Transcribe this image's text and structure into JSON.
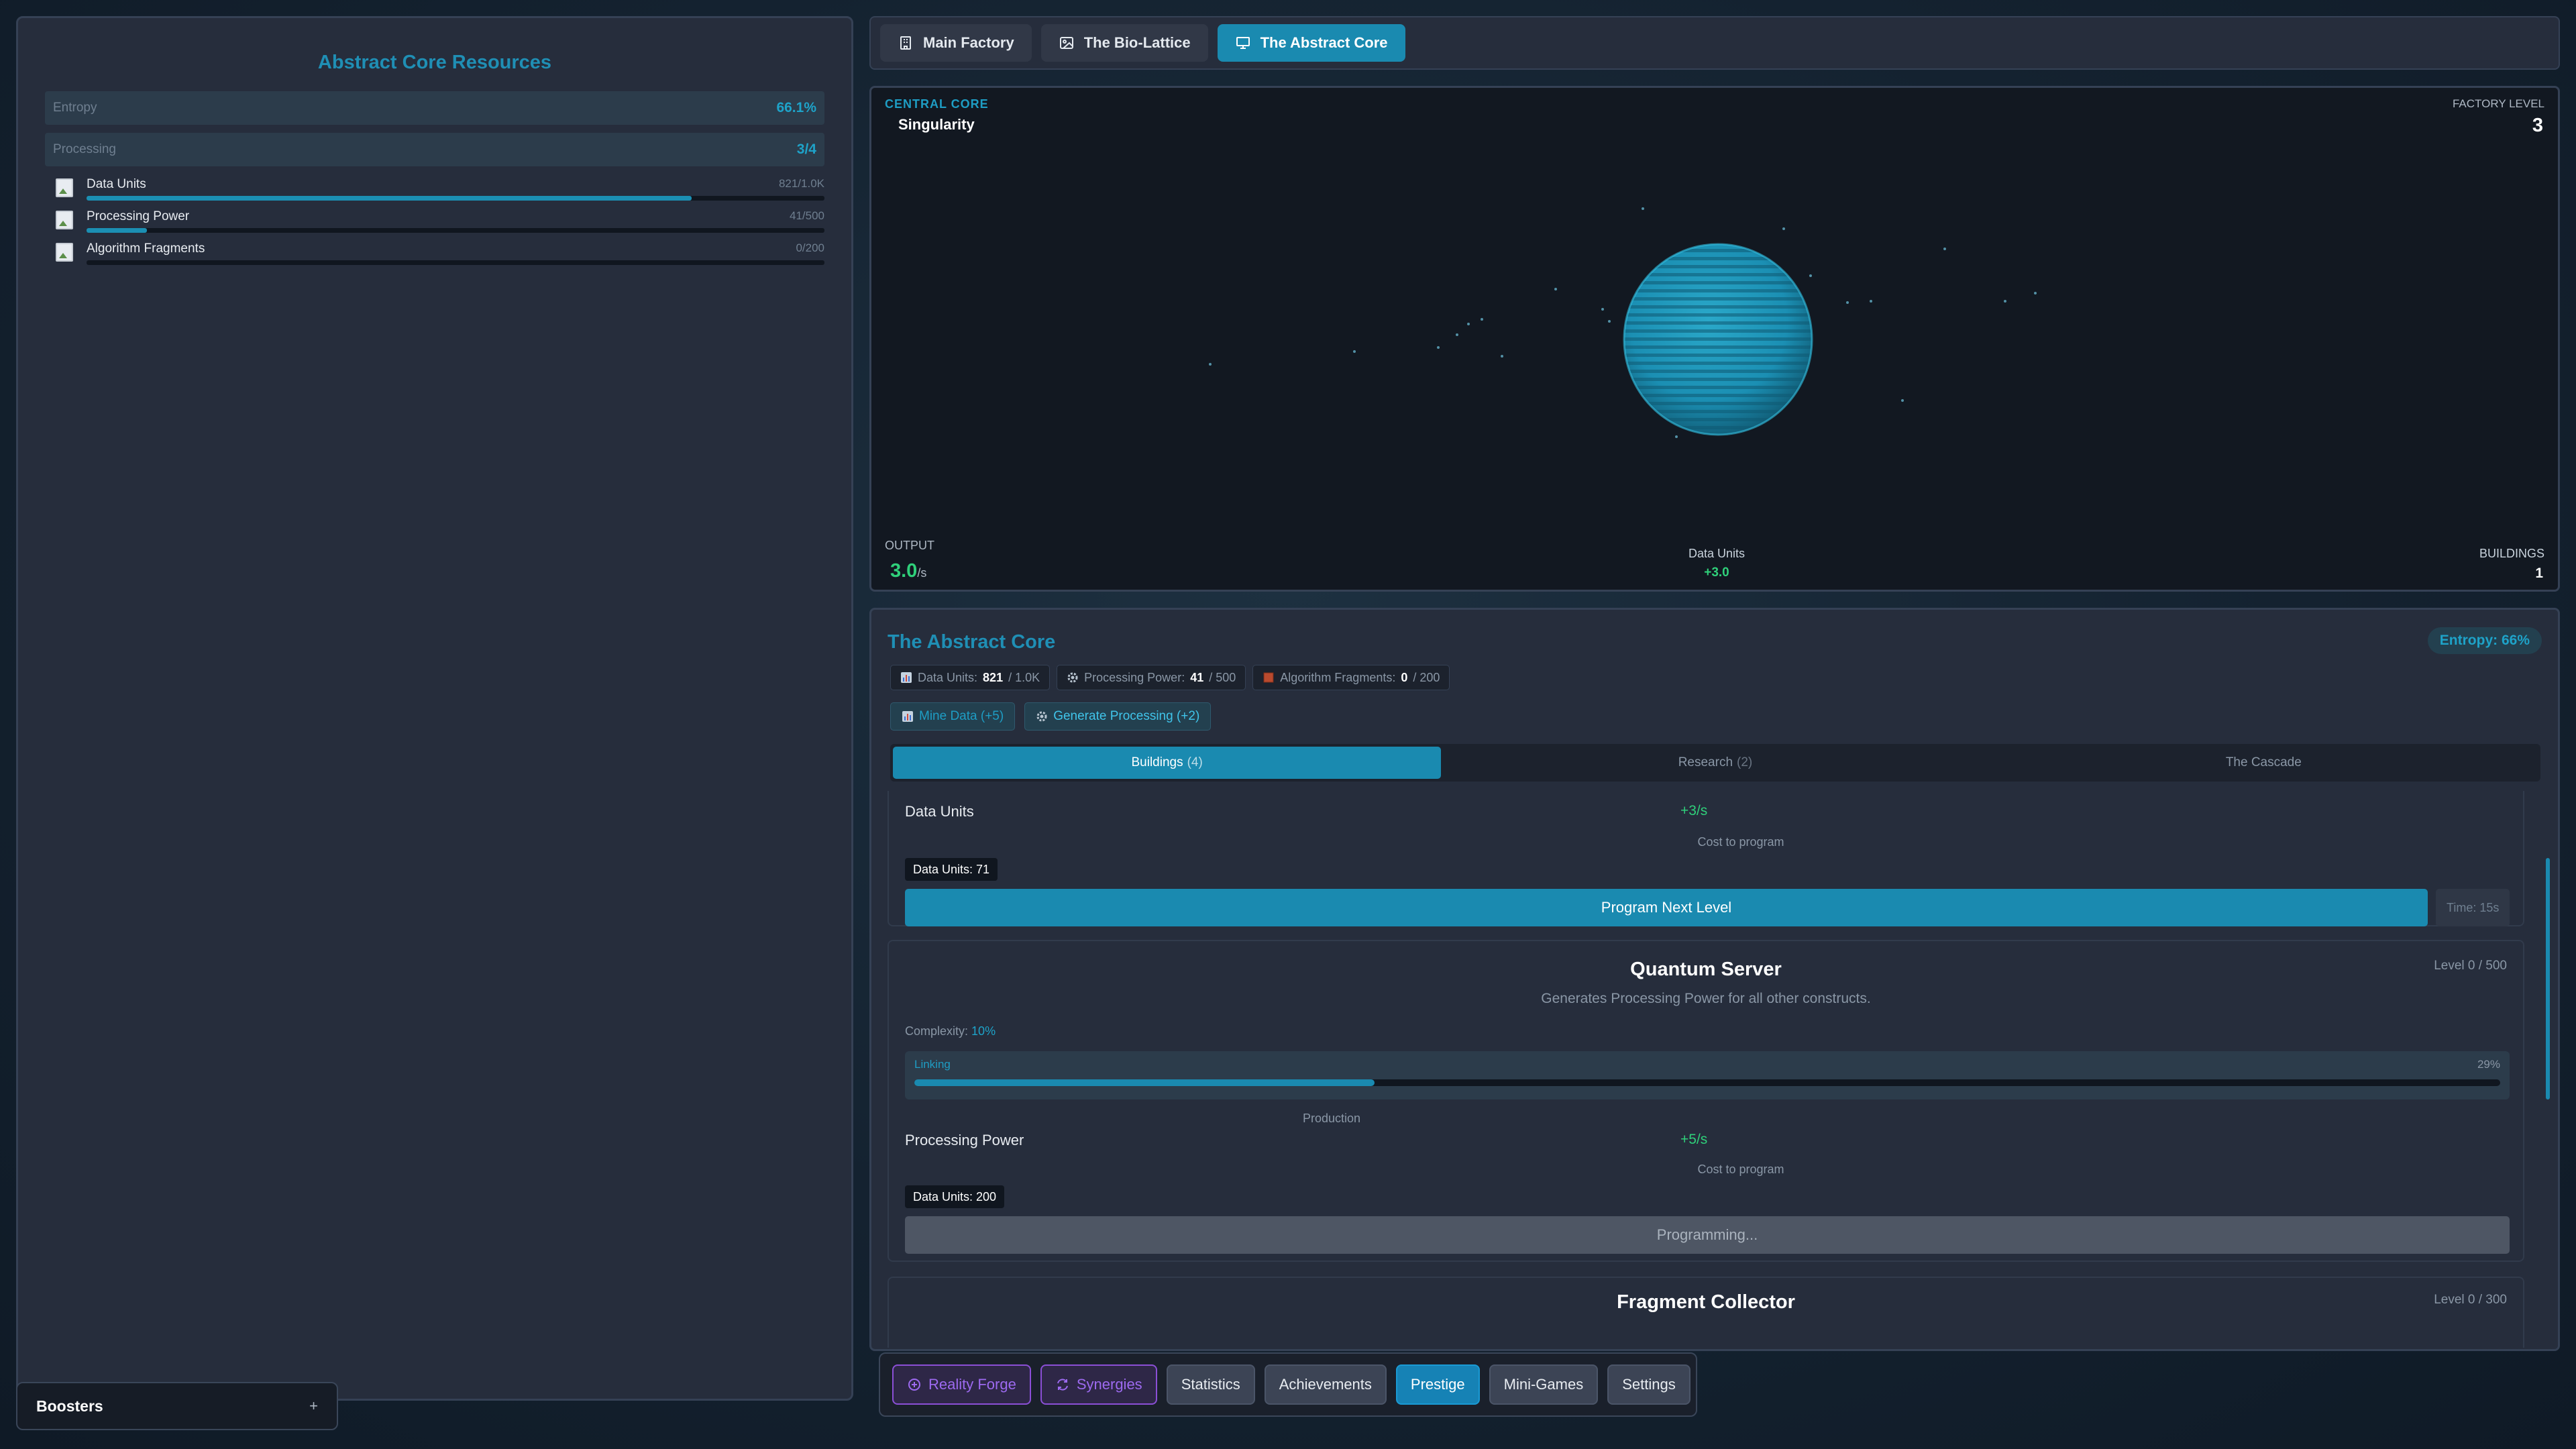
{
  "left_panel": {
    "title": "Abstract Core Resources",
    "stats": [
      {
        "label": "Entropy",
        "value": "66.1%"
      },
      {
        "label": "Processing",
        "value": "3/4"
      }
    ],
    "resources": [
      {
        "name": "Data Units",
        "value": "821/1.0K",
        "fill": 0.82
      },
      {
        "name": "Processing Power",
        "value": "41/500",
        "fill": 0.082
      },
      {
        "name": "Algorithm Fragments",
        "value": "0/200",
        "fill": 0
      }
    ]
  },
  "boosters": {
    "label": "Boosters",
    "toggle": "+"
  },
  "top_tabs": [
    {
      "label": "Main Factory",
      "icon": "building-icon",
      "active": false
    },
    {
      "label": "The Bio-Lattice",
      "icon": "image-icon",
      "active": false
    },
    {
      "label": "The Abstract Core",
      "icon": "monitor-icon",
      "active": true
    }
  ],
  "core_view": {
    "section_label": "CENTRAL CORE",
    "core_name": "Singularity",
    "factory_level_label": "FACTORY LEVEL",
    "factory_level": "3",
    "output_label": "OUTPUT",
    "output_value": "3.0",
    "output_unit": "/s",
    "resource_label": "Data Units",
    "resource_rate": "+3.0",
    "buildings_label": "BUILDINGS",
    "buildings_count": "1",
    "sphere_color": "#1b8fb3"
  },
  "detail": {
    "title": "The Abstract Core",
    "entropy_badge": "Entropy: 66%",
    "chips": [
      {
        "label": "Data Units:",
        "value": "821",
        "max": "/ 1.0K",
        "icon": "chart-icon"
      },
      {
        "label": "Processing Power:",
        "value": "41",
        "max": "/ 500",
        "icon": "gear-icon"
      },
      {
        "label": "Algorithm Fragments:",
        "value": "0",
        "max": "/ 200",
        "icon": "fragment-icon"
      }
    ],
    "actions": [
      {
        "label": "Mine Data (+5)",
        "icon": "chart-icon"
      },
      {
        "label": "Generate Processing (+2)",
        "icon": "gear-icon"
      }
    ],
    "subtabs": [
      {
        "label": "Buildings",
        "count": "(4)",
        "active": true
      },
      {
        "label": "Research",
        "count": "(2)",
        "active": false
      },
      {
        "label": "The Cascade",
        "count": "",
        "active": false
      }
    ],
    "data_card": {
      "resource": "Data Units",
      "rate": "+3/s",
      "cost_label": "Cost to program",
      "cost": "Data Units: 71",
      "button": "Program Next Level",
      "time": "Time: 15s"
    },
    "quantum_card": {
      "title": "Quantum Server",
      "level": "Level 0 / 500",
      "description": "Generates Processing Power for all other constructs.",
      "complexity_label": "Complexity:",
      "complexity_value": "10%",
      "linking_label": "Linking",
      "linking_pct": "29%",
      "linking_fill": 0.29,
      "production_label": "Production",
      "resource": "Processing Power",
      "rate": "+5/s",
      "cost_label": "Cost to program",
      "cost": "Data Units: 200",
      "button": "Programming..."
    },
    "fragment_card": {
      "title": "Fragment Collector",
      "level": "Level 0 / 300"
    }
  },
  "bottom_nav": [
    {
      "label": "Reality Forge",
      "style": "purple",
      "icon": "forge-icon"
    },
    {
      "label": "Synergies",
      "style": "purple",
      "icon": "sync-icon"
    },
    {
      "label": "Statistics",
      "style": "normal",
      "icon": ""
    },
    {
      "label": "Achievements",
      "style": "normal",
      "icon": ""
    },
    {
      "label": "Prestige",
      "style": "prestige",
      "icon": ""
    },
    {
      "label": "Mini-Games",
      "style": "normal",
      "icon": ""
    },
    {
      "label": "Settings",
      "style": "normal",
      "icon": ""
    }
  ]
}
